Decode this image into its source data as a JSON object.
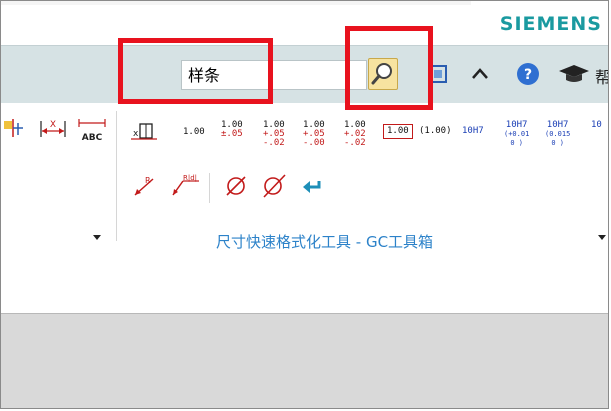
{
  "brand": {
    "logo_text": "SIEMENS",
    "color": "#1a9aa0"
  },
  "toolbar": {
    "search_value": "样条",
    "search_icon": "magnifier-icon",
    "buttons": [
      {
        "name": "window-icon",
        "label": ""
      },
      {
        "name": "collapse-ribbon-icon",
        "label": ""
      },
      {
        "name": "help-icon",
        "label": ""
      },
      {
        "name": "learning-cap-icon",
        "label": ""
      }
    ],
    "cut_text": "帮"
  },
  "ribbon": {
    "left_tools": [
      {
        "name": "ordinate-dim-icon",
        "label": ""
      },
      {
        "name": "horizontal-x-dim-icon",
        "label": "X"
      },
      {
        "name": "abc-dim-icon",
        "label": "ABC"
      }
    ],
    "formats": [
      {
        "name": "format-plain",
        "main": "1.00",
        "sub1": "",
        "sub2": ""
      },
      {
        "name": "format-symmetric",
        "main": "1.00",
        "sub1": "±.05",
        "sub2": ""
      },
      {
        "name": "format-plus-minus",
        "main": "1.00",
        "sub1": "+.05",
        "sub2": "-.02"
      },
      {
        "name": "format-plus-zero",
        "main": "1.00",
        "sub1": "+.05",
        "sub2": "-.00"
      },
      {
        "name": "format-limit",
        "main": "1.00",
        "sub1": "+.02",
        "sub2": "-.02"
      },
      {
        "name": "format-basic-box",
        "main": "1.00",
        "sub1": "",
        "sub2": ""
      },
      {
        "name": "format-reference",
        "main": "(1.00)",
        "sub1": "",
        "sub2": ""
      },
      {
        "name": "format-fit-class",
        "main": "10H7",
        "sub1": "",
        "sub2": ""
      },
      {
        "name": "format-fit-tolerance-1",
        "main": "10H7",
        "sub1": "(+0.01",
        "sub2": "0 )"
      },
      {
        "name": "format-fit-tolerance-2",
        "main": "10H7",
        "sub1": "(0.015",
        "sub2": "0 )"
      },
      {
        "name": "format-fit-tolerance-3",
        "main": "10",
        "sub1": "",
        "sub2": ""
      }
    ],
    "row2_tools": [
      {
        "name": "radius-dim-icon",
        "label": "R"
      },
      {
        "name": "radius-diameter-icon",
        "label": "R|d|"
      },
      {
        "name": "diameter-icon",
        "label": "Ø"
      },
      {
        "name": "diameter-slash-icon",
        "label": "Ø"
      },
      {
        "name": "undo-arrow-icon",
        "label": ""
      }
    ],
    "group_label": "尺寸快速格式化工具 - GC工具箱"
  },
  "colors": {
    "ribbon_strip": "#d6e2e4",
    "highlight": "#e8121e",
    "group_label": "#2c82c9",
    "tolerance_red": "#c21a1a",
    "tolerance_blue": "#1b3fb5"
  }
}
